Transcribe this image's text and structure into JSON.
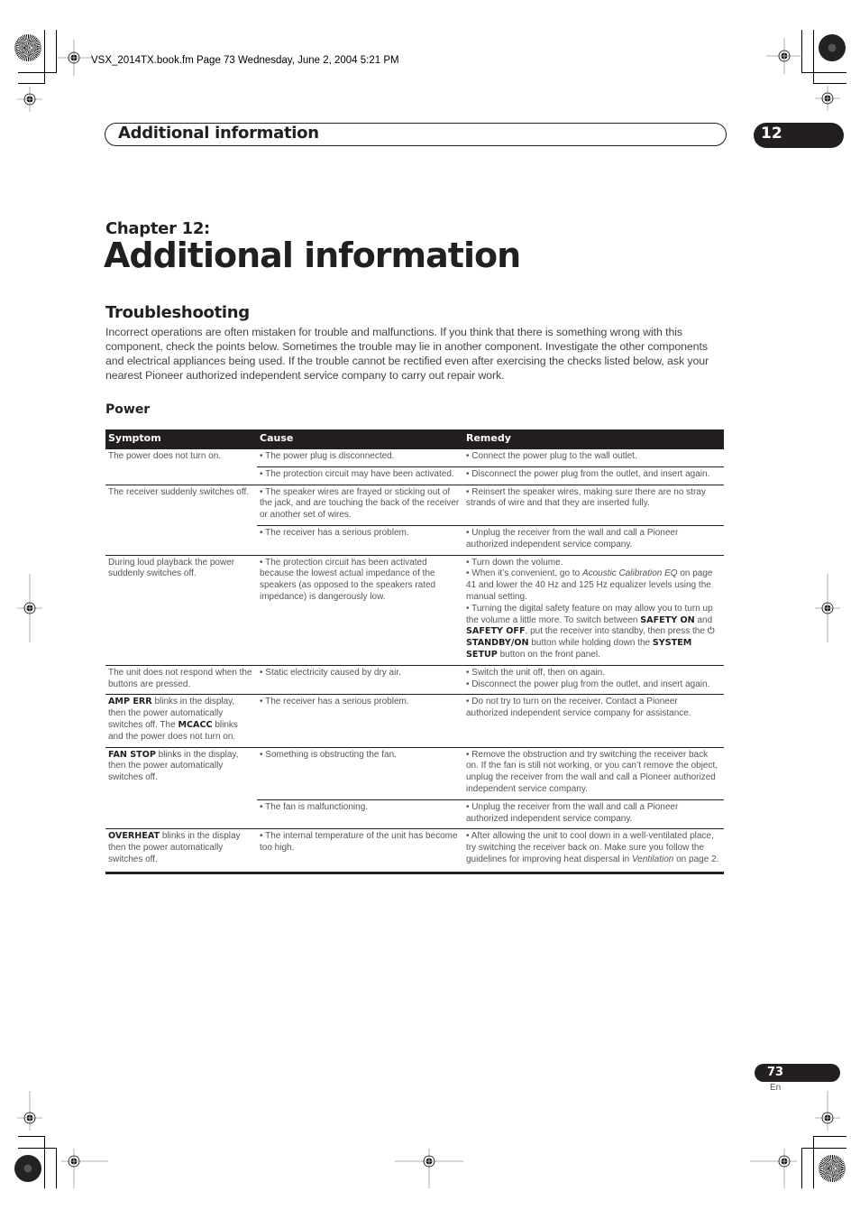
{
  "print_marks": {
    "file_stamp": "VSX_2014TX.book.fm  Page 73  Wednesday, June 2, 2004  5:21 PM"
  },
  "header": {
    "section_title": "Additional information",
    "chapter_number": "12"
  },
  "chapter": {
    "label": "Chapter 12:",
    "title": "Additional information"
  },
  "troubleshooting": {
    "title": "Troubleshooting",
    "intro": "Incorrect operations are often mistaken for trouble and malfunctions. If you think that there is something wrong with this component, check the points below. Sometimes the trouble may lie in another component. Investigate the other components and electrical appliances being used. If the trouble cannot be rectified even after exercising the checks listed below, ask your nearest Pioneer authorized independent service company to carry out repair work."
  },
  "power": {
    "title": "Power",
    "columns": [
      "Symptom",
      "Cause",
      "Remedy"
    ],
    "rows": [
      {
        "symptom": "The power does not turn on.",
        "entries": [
          {
            "cause": "• The power plug is disconnected.",
            "remedy": [
              "• Connect the power plug to the wall outlet."
            ]
          },
          {
            "cause": "• The protection circuit may have been activated.",
            "remedy": [
              "• Disconnect the power plug from the outlet, and insert again."
            ]
          }
        ]
      },
      {
        "symptom": "The receiver suddenly switches off.",
        "entries": [
          {
            "cause": "• The speaker wires are frayed or sticking out of the jack, and are touching the back of the receiver or another set of wires.",
            "remedy": [
              "• Reinsert the speaker wires, making sure there are no stray strands of wire and that they are inserted fully."
            ]
          },
          {
            "cause": "• The receiver has a serious problem.",
            "remedy": [
              "• Unplug the receiver from the wall and call a Pioneer authorized independent service company."
            ]
          }
        ]
      },
      {
        "symptom": "During loud playback the power suddenly switches off.",
        "entries": [
          {
            "cause": "• The protection circuit has been activated because the lowest actual impedance of the speakers (as opposed to the speakers rated impedance) is dangerously low.",
            "remedy": [
              "• Turn down the volume."
            ],
            "remedy_2": {
              "pre": "• When it’s convenient, go to ",
              "italic": "Acoustic Calibration EQ",
              "post": " on page 41 and lower the 40 Hz and 125 Hz equalizer levels using the manual setting."
            },
            "remedy_3": {
              "t1": "• Turning the digital safety feature on may allow you to turn up the volume a little more. To switch between ",
              "b1": "SAFETY ON",
              "t2": " and ",
              "b2": "SAFETY OFF",
              "t3": ", put the receiver into standby, then press the ",
              "power_icon": "⏻",
              "b3": "STANDBY/ON",
              "t4": " button while holding down the ",
              "b4": "SYSTEM SETUP",
              "t5": " button on the front panel."
            }
          }
        ]
      },
      {
        "symptom": "The unit does not respond when the buttons are pressed.",
        "entries": [
          {
            "cause": "• Static electricity caused by dry air.",
            "remedy": [
              "• Switch the unit off, then on again.",
              "• Disconnect the power plug from the outlet, and insert again."
            ]
          }
        ]
      },
      {
        "symptom_rich": {
          "b1": "AMP ERR",
          "t1": " blinks in the display, then the power automatically switches off. The ",
          "b2": "MCACC",
          "t2": " blinks and the power does not turn on."
        },
        "entries": [
          {
            "cause": "• The receiver has a serious problem.",
            "remedy": [
              "• Do not try to turn on the receiver. Contact a Pioneer authorized independent service company for assistance."
            ]
          }
        ]
      },
      {
        "symptom_rich": {
          "b1": "FAN STOP",
          "t1": " blinks in the display, then the power automatically switches off."
        },
        "entries": [
          {
            "cause": "• Something is obstructing the fan.",
            "remedy": [
              "• Remove the obstruction and try switching the receiver back on. If the fan is still not working, or you can’t remove the object, unplug the receiver from the wall and call a Pioneer authorized independent service company."
            ]
          },
          {
            "cause": "• The fan is malfunctioning.",
            "remedy": [
              "• Unplug the receiver from the wall and call a Pioneer authorized independent service company."
            ]
          }
        ]
      },
      {
        "symptom_rich": {
          "b1": "OVERHEAT",
          "t1": " blinks in the display then the power automatically switches off."
        },
        "entries": [
          {
            "cause": "• The internal temperature of the unit has become too high.",
            "remedy_rich": {
              "pre": "• After allowing the unit to cool down in a well-ventilated place, try switching the receiver back on. Make sure you follow the guidelines for improving heat dispersal in ",
              "italic": "Ventilation",
              "post": " on page 2."
            }
          }
        ]
      }
    ]
  },
  "footer": {
    "page_number": "73",
    "language": "En"
  }
}
